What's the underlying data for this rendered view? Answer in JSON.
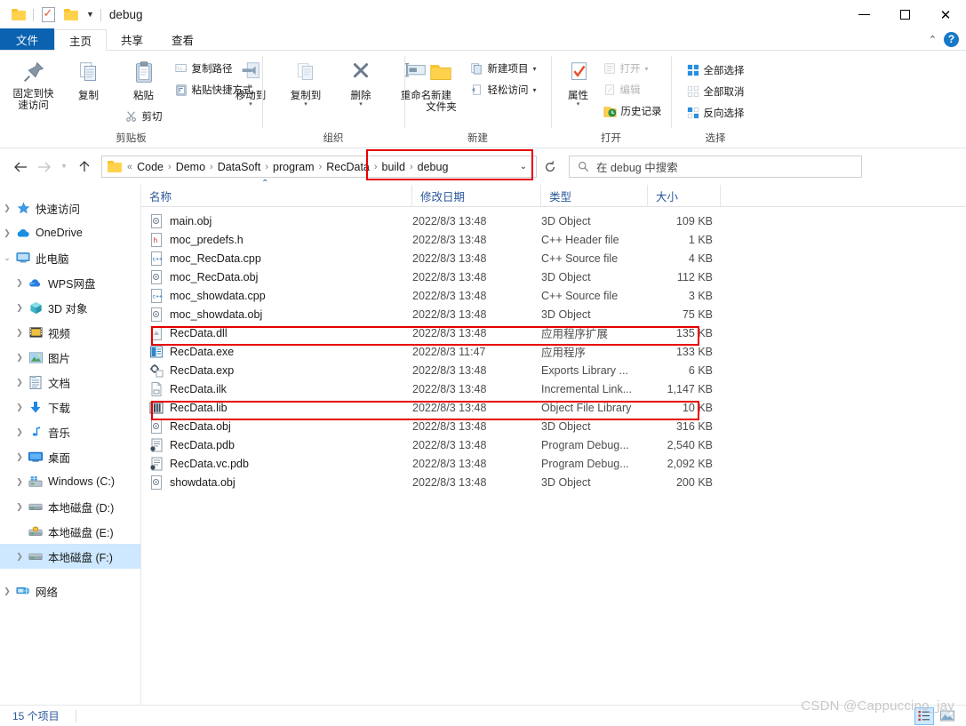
{
  "window": {
    "title": "debug",
    "quick_access": [
      "folder-icon",
      "properties-icon",
      "new-folder-icon"
    ],
    "controls": {
      "minimize": "minimize-icon",
      "maximize": "maximize-icon",
      "close": "close-icon"
    }
  },
  "ribbon": {
    "tabs": [
      {
        "label": "文件",
        "kind": "file"
      },
      {
        "label": "主页",
        "kind": "active"
      },
      {
        "label": "共享",
        "kind": "normal"
      },
      {
        "label": "查看",
        "kind": "normal"
      }
    ],
    "collapse_icon": "chevron-up-icon",
    "help_icon": "help-icon",
    "groups": [
      {
        "label": "剪贴板",
        "big": [
          {
            "label": "固定到快\n速访问",
            "line1": "固定到快",
            "line2": "速访问",
            "icon": "pin-icon"
          },
          {
            "label": "复制",
            "line1": "复制",
            "line2": "",
            "icon": "copy-icon"
          },
          {
            "label": "粘贴",
            "line1": "粘贴",
            "line2": "",
            "icon": "paste-icon"
          }
        ],
        "small": [
          {
            "label": "复制路径",
            "icon": "copy-path-icon",
            "dim": false
          },
          {
            "label": "粘贴快捷方式",
            "icon": "paste-shortcut-icon",
            "dim": false
          },
          {
            "label": "剪切",
            "icon": "scissors-icon",
            "dim": false
          }
        ]
      },
      {
        "label": "组织",
        "big": [
          {
            "line1": "移动到",
            "line2": "",
            "icon": "move-to-icon",
            "caret": true
          },
          {
            "line1": "复制到",
            "line2": "",
            "icon": "copy-to-icon",
            "caret": true
          },
          {
            "line1": "删除",
            "line2": "",
            "icon": "delete-icon",
            "caret": true
          },
          {
            "line1": "重命名",
            "line2": "",
            "icon": "rename-icon",
            "caret": false
          }
        ],
        "small": []
      },
      {
        "label": "新建",
        "big": [
          {
            "line1": "新建",
            "line2": "文件夹",
            "icon": "new-folder-icon",
            "caret": false
          }
        ],
        "small": [
          {
            "label": "新建项目",
            "icon": "new-item-icon",
            "dropdown": true
          },
          {
            "label": "轻松访问",
            "icon": "easy-access-icon",
            "dropdown": true
          }
        ]
      },
      {
        "label": "打开",
        "big": [
          {
            "line1": "属性",
            "line2": "",
            "icon": "properties-icon",
            "caret": true
          }
        ],
        "small": [
          {
            "label": "打开",
            "icon": "open-icon",
            "dim": true,
            "dropdown": true
          },
          {
            "label": "编辑",
            "icon": "edit-icon",
            "dim": true
          },
          {
            "label": "历史记录",
            "icon": "history-icon",
            "dim": false
          }
        ]
      },
      {
        "label": "选择",
        "big": [],
        "small": [
          {
            "label": "全部选择",
            "icon": "select-all-icon"
          },
          {
            "label": "全部取消",
            "icon": "select-none-icon"
          },
          {
            "label": "反向选择",
            "icon": "invert-selection-icon"
          }
        ]
      }
    ]
  },
  "addressbar": {
    "back_icon": "back-arrow-icon",
    "forward_icon": "forward-arrow-icon",
    "recent_icon": "chevron-down-icon",
    "up_icon": "up-arrow-icon",
    "overflow": "«",
    "breadcrumbs": [
      "Code",
      "Demo",
      "DataSoft",
      "program",
      "RecData",
      "build",
      "debug"
    ],
    "dropdown_icon": "chevron-down-icon",
    "refresh_icon": "refresh-icon",
    "search": {
      "icon": "search-icon",
      "placeholder": "在 debug 中搜索",
      "value": ""
    }
  },
  "navpane": {
    "items": [
      {
        "label": "快速访问",
        "icon": "star-icon",
        "depth": 0,
        "expander": "collapsed",
        "selected": false
      },
      {
        "label": "OneDrive",
        "icon": "cloud-icon",
        "depth": 0,
        "expander": "collapsed",
        "selected": false
      },
      {
        "label": "此电脑",
        "icon": "computer-icon",
        "depth": 0,
        "expander": "expanded",
        "selected": false
      },
      {
        "label": "WPS网盘",
        "icon": "wps-cloud-icon",
        "depth": 1,
        "expander": "collapsed",
        "selected": false
      },
      {
        "label": "3D 对象",
        "icon": "3d-objects-icon",
        "depth": 1,
        "expander": "collapsed",
        "selected": false
      },
      {
        "label": "视频",
        "icon": "videos-icon",
        "depth": 1,
        "expander": "collapsed",
        "selected": false
      },
      {
        "label": "图片",
        "icon": "pictures-icon",
        "depth": 1,
        "expander": "collapsed",
        "selected": false
      },
      {
        "label": "文档",
        "icon": "documents-icon",
        "depth": 1,
        "expander": "collapsed",
        "selected": false
      },
      {
        "label": "下载",
        "icon": "downloads-icon",
        "depth": 1,
        "expander": "collapsed",
        "selected": false
      },
      {
        "label": "音乐",
        "icon": "music-icon",
        "depth": 1,
        "expander": "collapsed",
        "selected": false
      },
      {
        "label": "桌面",
        "icon": "desktop-icon",
        "depth": 1,
        "expander": "collapsed",
        "selected": false
      },
      {
        "label": "Windows (C:)",
        "icon": "windows-drive-icon",
        "depth": 1,
        "expander": "collapsed",
        "selected": false
      },
      {
        "label": "本地磁盘 (D:)",
        "icon": "drive-icon",
        "depth": 1,
        "expander": "collapsed",
        "selected": false
      },
      {
        "label": "本地磁盘 (E:)",
        "icon": "locked-drive-icon",
        "depth": 1,
        "expander": "none",
        "selected": false
      },
      {
        "label": "本地磁盘 (F:)",
        "icon": "drive-icon",
        "depth": 1,
        "expander": "collapsed",
        "selected": true
      },
      {
        "label": "网络",
        "icon": "network-icon",
        "depth": 0,
        "expander": "collapsed",
        "selected": false
      }
    ]
  },
  "filelist": {
    "columns": [
      {
        "label": "名称",
        "key": "name"
      },
      {
        "label": "修改日期",
        "key": "date"
      },
      {
        "label": "类型",
        "key": "type"
      },
      {
        "label": "大小",
        "key": "size"
      }
    ],
    "sort_column": "名称",
    "sort_direction": "asc",
    "rows": [
      {
        "name": "main.obj",
        "date": "2022/8/3 13:48",
        "type": "3D Object",
        "size": "109 KB",
        "icon": "obj-file-icon",
        "highlight": false
      },
      {
        "name": "moc_predefs.h",
        "date": "2022/8/3 13:48",
        "type": "C++ Header file",
        "size": "1 KB",
        "icon": "h-file-icon",
        "highlight": false
      },
      {
        "name": "moc_RecData.cpp",
        "date": "2022/8/3 13:48",
        "type": "C++ Source file",
        "size": "4 KB",
        "icon": "cpp-file-icon",
        "highlight": false
      },
      {
        "name": "moc_RecData.obj",
        "date": "2022/8/3 13:48",
        "type": "3D Object",
        "size": "112 KB",
        "icon": "obj-file-icon",
        "highlight": false
      },
      {
        "name": "moc_showdata.cpp",
        "date": "2022/8/3 13:48",
        "type": "C++ Source file",
        "size": "3 KB",
        "icon": "cpp-file-icon",
        "highlight": false
      },
      {
        "name": "moc_showdata.obj",
        "date": "2022/8/3 13:48",
        "type": "3D Object",
        "size": "75 KB",
        "icon": "obj-file-icon",
        "highlight": false
      },
      {
        "name": "RecData.dll",
        "date": "2022/8/3 13:48",
        "type": "应用程序扩展",
        "size": "135 KB",
        "icon": "dll-file-icon",
        "highlight": true
      },
      {
        "name": "RecData.exe",
        "date": "2022/8/3 11:47",
        "type": "应用程序",
        "size": "133 KB",
        "icon": "exe-file-icon",
        "highlight": false
      },
      {
        "name": "RecData.exp",
        "date": "2022/8/3 13:48",
        "type": "Exports Library ...",
        "size": "6 KB",
        "icon": "exp-file-icon",
        "highlight": false
      },
      {
        "name": "RecData.ilk",
        "date": "2022/8/3 13:48",
        "type": "Incremental Link...",
        "size": "1,147 KB",
        "icon": "ilk-file-icon",
        "highlight": false
      },
      {
        "name": "RecData.lib",
        "date": "2022/8/3 13:48",
        "type": "Object File Library",
        "size": "10 KB",
        "icon": "lib-file-icon",
        "highlight": true
      },
      {
        "name": "RecData.obj",
        "date": "2022/8/3 13:48",
        "type": "3D Object",
        "size": "316 KB",
        "icon": "obj-file-icon",
        "highlight": false
      },
      {
        "name": "RecData.pdb",
        "date": "2022/8/3 13:48",
        "type": "Program Debug...",
        "size": "2,540 KB",
        "icon": "pdb-file-icon",
        "highlight": false
      },
      {
        "name": "RecData.vc.pdb",
        "date": "2022/8/3 13:48",
        "type": "Program Debug...",
        "size": "2,092 KB",
        "icon": "pdb-file-icon",
        "highlight": false
      },
      {
        "name": "showdata.obj",
        "date": "2022/8/3 13:48",
        "type": "3D Object",
        "size": "200 KB",
        "icon": "obj-file-icon",
        "highlight": false
      }
    ]
  },
  "statusbar": {
    "item_count": "15 个项目",
    "views": [
      {
        "name": "details-view",
        "selected": true
      },
      {
        "name": "large-icons-view",
        "selected": false
      }
    ]
  },
  "watermark": "CSDN @Cappuccino_jay",
  "colors": {
    "accent": "#0a62b0",
    "header_text": "#2b579a",
    "selection": "#cde8ff",
    "annotation": "#e60000",
    "folder": "#ffd24d"
  }
}
